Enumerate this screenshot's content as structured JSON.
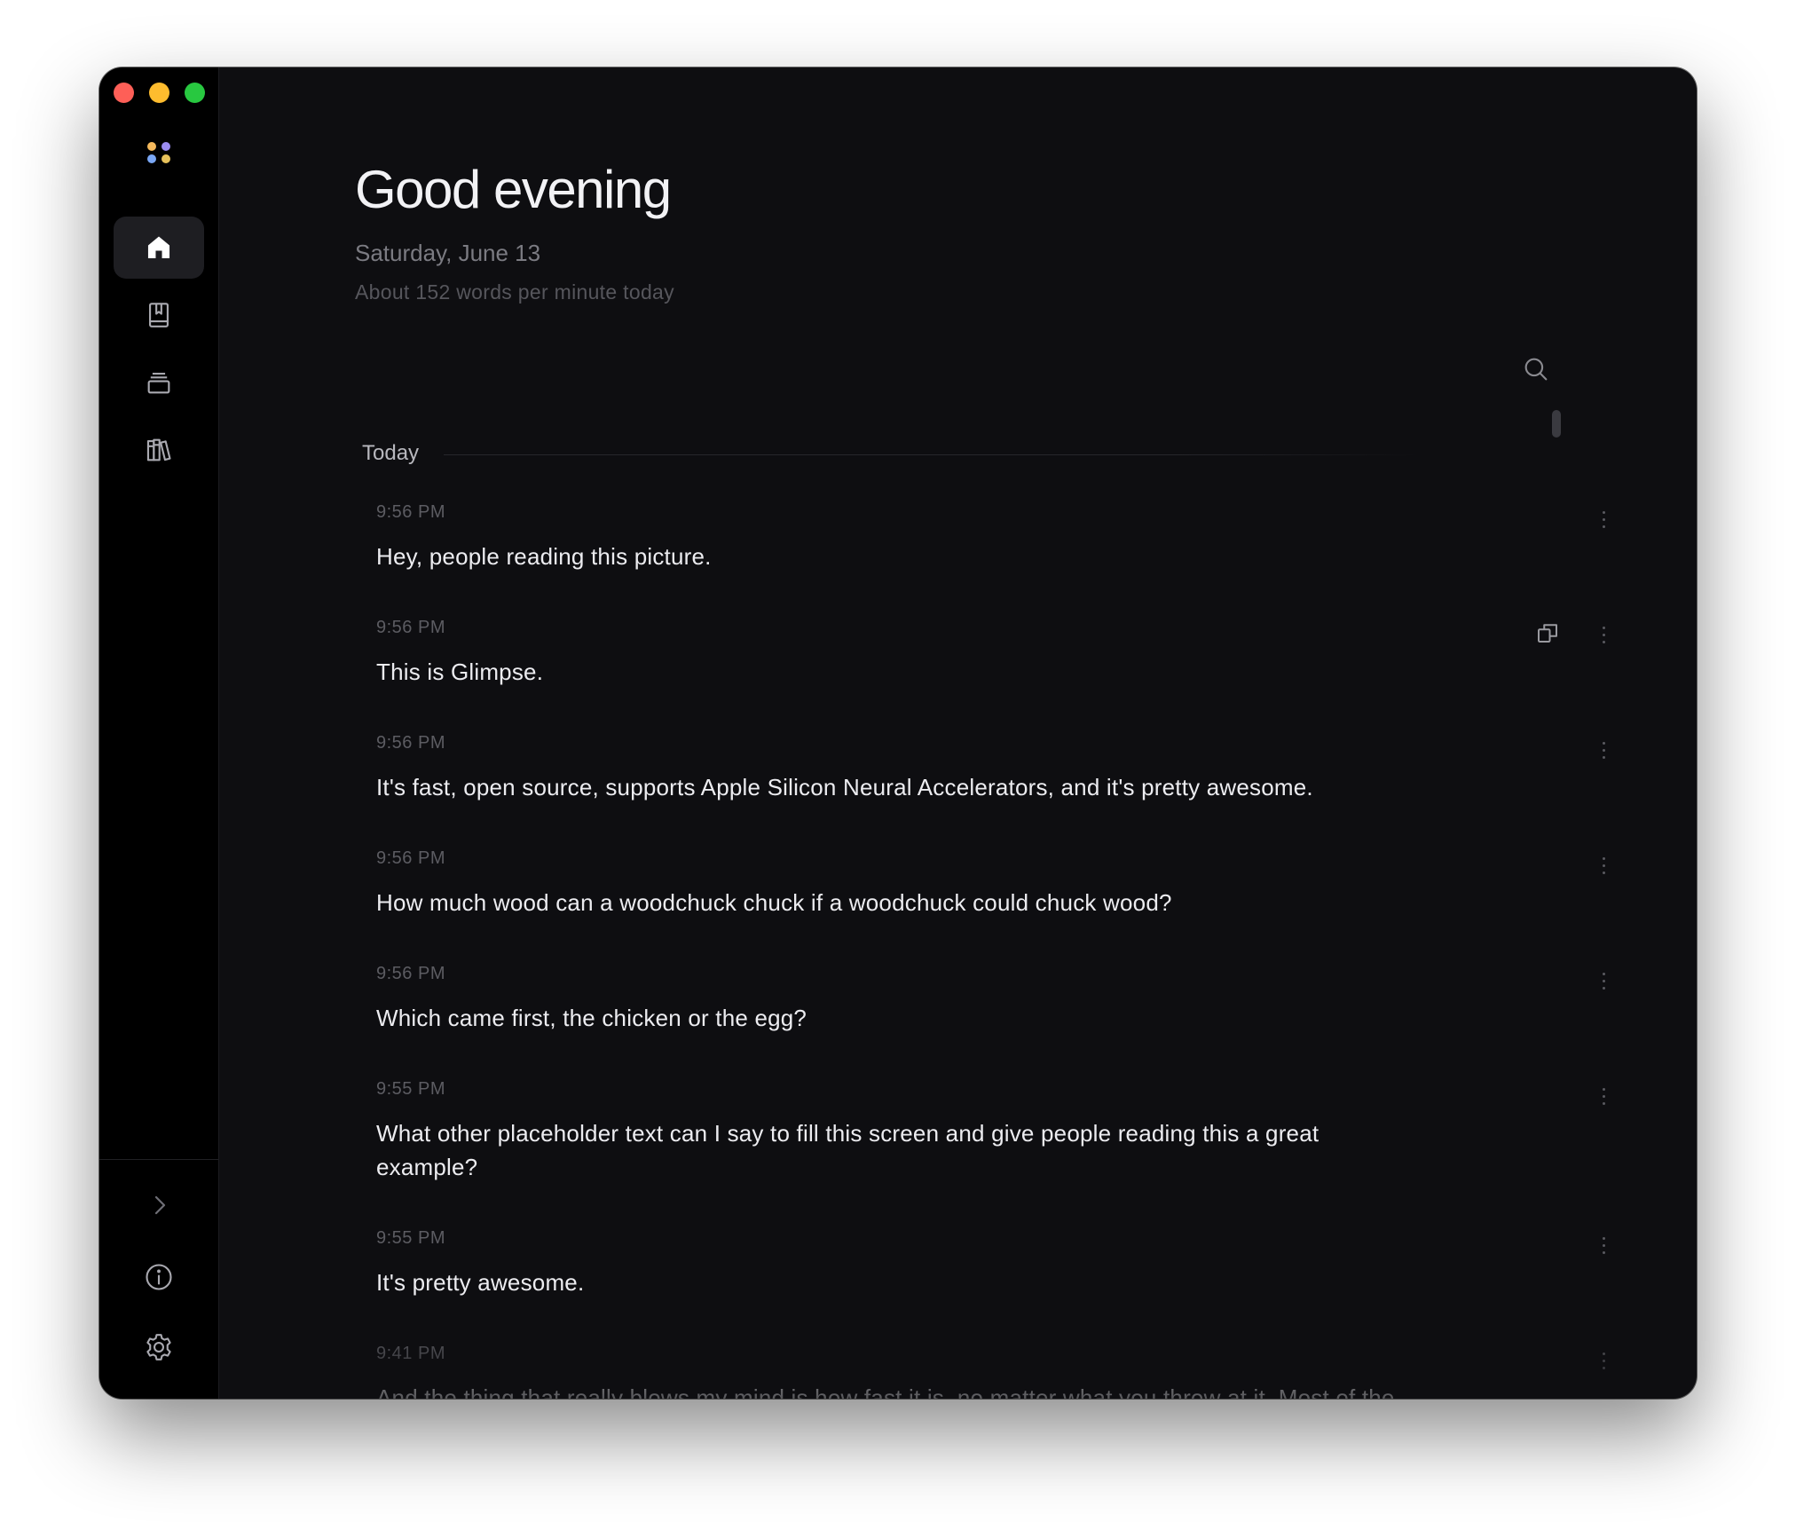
{
  "window": {
    "traffic_lights": {
      "close": "#fe5f57",
      "minimize": "#febc2e",
      "maximize": "#28c840"
    }
  },
  "sidebar": {
    "logo": {
      "icon": "four-dots-logo-icon",
      "colors": [
        "#f4b95c",
        "#9b8cf0",
        "#7aa7f5",
        "#e7c15a"
      ]
    },
    "nav": [
      {
        "name": "home",
        "icon": "home-icon",
        "active": true
      },
      {
        "name": "bookmarks",
        "icon": "bookmark-book-icon",
        "active": false
      },
      {
        "name": "history",
        "icon": "stacked-cards-icon",
        "active": false
      },
      {
        "name": "library",
        "icon": "books-icon",
        "active": false
      }
    ],
    "bottom": [
      {
        "name": "expand",
        "icon": "chevron-right-icon"
      },
      {
        "name": "info",
        "icon": "info-icon"
      },
      {
        "name": "settings",
        "icon": "gear-icon"
      }
    ]
  },
  "header": {
    "greeting": "Good evening",
    "date": "Saturday, June 13",
    "stats": "About 152 words per minute today"
  },
  "toolbar": {
    "search_icon": "search-icon"
  },
  "section": {
    "label": "Today"
  },
  "entries": [
    {
      "time": "9:56 PM",
      "text": "Hey, people reading this picture."
    },
    {
      "time": "9:56 PM",
      "text": "This is Glimpse.",
      "show_copy": true
    },
    {
      "time": "9:56 PM",
      "text": "It's fast, open source, supports Apple Silicon Neural Accelerators, and it's pretty awesome."
    },
    {
      "time": "9:56 PM",
      "text": "How much wood can a woodchuck chuck if a woodchuck could chuck wood?"
    },
    {
      "time": "9:56 PM",
      "text": "Which came first, the chicken or the egg?"
    },
    {
      "time": "9:55 PM",
      "text": "What other placeholder text can I say to fill this screen and give people reading this a great example?"
    },
    {
      "time": "9:55 PM",
      "text": "It's pretty awesome."
    },
    {
      "time": "9:41 PM",
      "text": "And the thing that really blows my mind is how fast it is, no matter what you throw at it. Most of the stuff runs"
    }
  ],
  "colors": {
    "background": "#0e0e11",
    "sidebar": "#000000",
    "text_primary": "#ececf0",
    "text_secondary": "#7b7b82",
    "text_muted": "#56565c"
  }
}
